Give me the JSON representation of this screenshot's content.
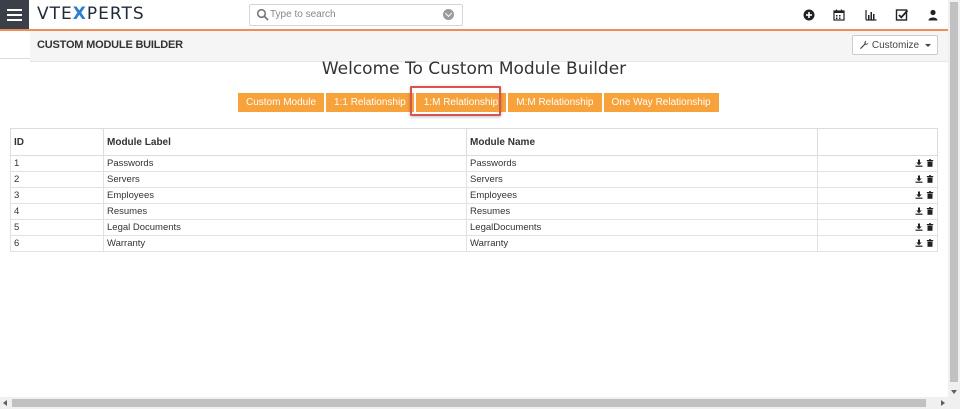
{
  "app": {
    "logo": {
      "part1": "VTE",
      "part2": "X",
      "part3": "PERTS"
    },
    "search": {
      "placeholder": "Type to search"
    },
    "toolbar_icons": [
      "plus-circle-icon",
      "calendar-icon",
      "bar-chart-icon",
      "check-square-icon",
      "user-icon"
    ],
    "colors": {
      "accent_orange": "#f7a23b",
      "highlight_red": "#d9534f",
      "logo_blue": "#2b7fd1",
      "menu_dark": "#3a3f48"
    }
  },
  "subheader": {
    "title": "CUSTOM MODULE BUILDER",
    "customize_label": "Customize"
  },
  "main": {
    "heading": "Welcome To Custom Module Builder",
    "tabs": [
      {
        "label": "Custom Module"
      },
      {
        "label": "1:1 Relationship"
      },
      {
        "label": "1:M Relationship",
        "highlighted": true
      },
      {
        "label": "M:M Relationship"
      },
      {
        "label": "One Way Relationship"
      }
    ]
  },
  "table": {
    "headers": [
      "ID",
      "Module Label",
      "Module Name",
      ""
    ],
    "rows": [
      {
        "id": "1",
        "label": "Passwords",
        "name": "Passwords"
      },
      {
        "id": "2",
        "label": "Servers",
        "name": "Servers"
      },
      {
        "id": "3",
        "label": "Employees",
        "name": "Employees"
      },
      {
        "id": "4",
        "label": "Resumes",
        "name": "Resumes"
      },
      {
        "id": "5",
        "label": "Legal Documents",
        "name": "LegalDocuments"
      },
      {
        "id": "6",
        "label": "Warranty",
        "name": "Warranty"
      }
    ],
    "row_action_icons": [
      "download-icon",
      "trash-icon"
    ]
  }
}
